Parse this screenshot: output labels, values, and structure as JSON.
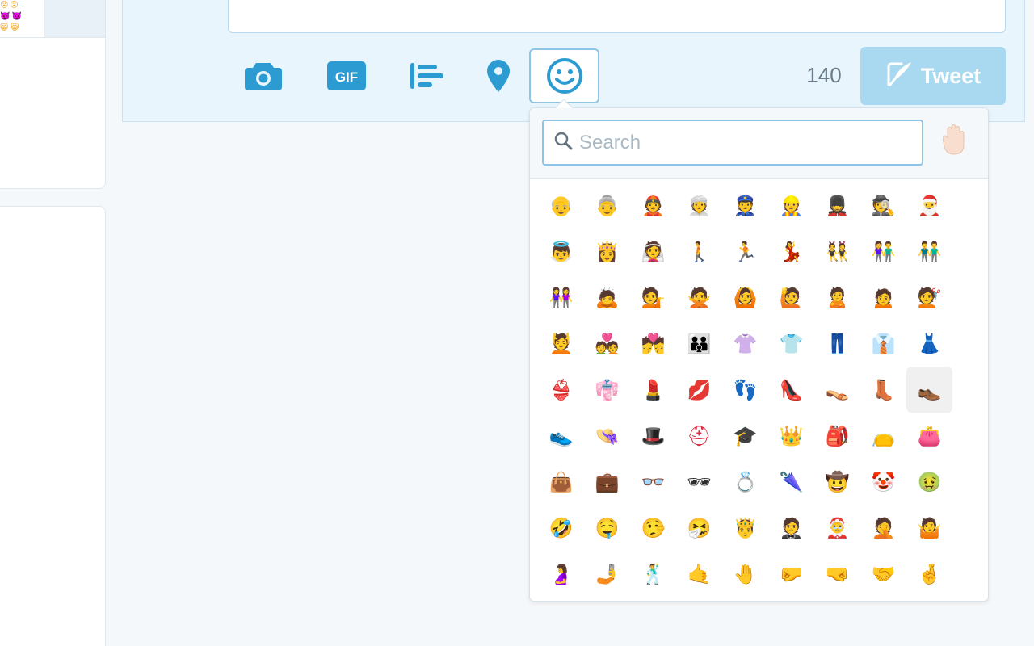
{
  "toolbar": {
    "counter": "140",
    "tweet_label": "Tweet",
    "accent": "#1da1f2",
    "icon_color": "#2b9bd1"
  },
  "picker": {
    "search_placeholder": "Search",
    "skin_tone_icon": "raised-hand",
    "highlighted_index": 44,
    "emojis": [
      {
        "name": "older-man",
        "glyph": "👴",
        "color": "#f3d6c4"
      },
      {
        "name": "older-woman",
        "glyph": "👵",
        "color": "#f3d6c4"
      },
      {
        "name": "man-with-gua-pi-mao",
        "glyph": "👲",
        "color": "#f3d6c4"
      },
      {
        "name": "man-with-turban",
        "glyph": "👳",
        "color": "#5c9e52"
      },
      {
        "name": "police-officer",
        "glyph": "👮",
        "color": "#3c5a8a"
      },
      {
        "name": "construction-worker",
        "glyph": "👷",
        "color": "#f5c518"
      },
      {
        "name": "guardsman",
        "glyph": "💂",
        "color": "#c22f3a"
      },
      {
        "name": "detective",
        "glyph": "🕵",
        "color": "#66757f"
      },
      {
        "name": "santa-claus",
        "glyph": "🎅",
        "color": "#dd2e44"
      },
      {
        "name": "baby-angel",
        "glyph": "👼",
        "color": "#f3d6c4"
      },
      {
        "name": "princess",
        "glyph": "👸",
        "color": "#2e2e2e"
      },
      {
        "name": "bride-with-veil",
        "glyph": "👰",
        "color": "#e1e8ed"
      },
      {
        "name": "pedestrian",
        "glyph": "🚶",
        "color": "#5c9e52"
      },
      {
        "name": "runner",
        "glyph": "🏃",
        "color": "#3c8fd6"
      },
      {
        "name": "dancer",
        "glyph": "💃",
        "color": "#dd2e44"
      },
      {
        "name": "dancers",
        "glyph": "👯",
        "color": "#f5c518"
      },
      {
        "name": "couple",
        "glyph": "👫",
        "color": "#f5c518"
      },
      {
        "name": "two-men-holding-hands",
        "glyph": "👬",
        "color": "#f5c518"
      },
      {
        "name": "two-women-holding-hands",
        "glyph": "👭",
        "color": "#f5c518"
      },
      {
        "name": "person-bowing",
        "glyph": "🙇",
        "color": "#3c8fd6"
      },
      {
        "name": "information-desk-person",
        "glyph": "💁",
        "color": "#9266cc"
      },
      {
        "name": "no-good-gesture",
        "glyph": "🙅",
        "color": "#9266cc"
      },
      {
        "name": "ok-gesture",
        "glyph": "🙆",
        "color": "#9266cc"
      },
      {
        "name": "raising-hand",
        "glyph": "🙋",
        "color": "#9266cc"
      },
      {
        "name": "person-pouting",
        "glyph": "🙎",
        "color": "#9266cc"
      },
      {
        "name": "person-frowning",
        "glyph": "🙍",
        "color": "#9266cc"
      },
      {
        "name": "haircut",
        "glyph": "💇",
        "color": "#2e2e2e"
      },
      {
        "name": "face-massage",
        "glyph": "💆",
        "color": "#2e2e2e"
      },
      {
        "name": "couple-with-heart",
        "glyph": "💑",
        "color": "#f5c518"
      },
      {
        "name": "kiss",
        "glyph": "💏",
        "color": "#f5c518"
      },
      {
        "name": "family",
        "glyph": "👪",
        "color": "#f5c518"
      },
      {
        "name": "womans-clothes",
        "glyph": "👚",
        "color": "#9266cc"
      },
      {
        "name": "t-shirt",
        "glyph": "👕",
        "color": "#3c8fd6"
      },
      {
        "name": "jeans",
        "glyph": "👖",
        "color": "#3c8fd6"
      },
      {
        "name": "necktie",
        "glyph": "👔",
        "color": "#3c8fd6"
      },
      {
        "name": "dress",
        "glyph": "👗",
        "color": "#3c8fd6"
      },
      {
        "name": "bikini",
        "glyph": "👙",
        "color": "#9266cc"
      },
      {
        "name": "kimono",
        "glyph": "👘",
        "color": "#3c8fd6"
      },
      {
        "name": "lipstick",
        "glyph": "💄",
        "color": "#dd2e44"
      },
      {
        "name": "kiss-mark",
        "glyph": "💋",
        "color": "#dd2e44"
      },
      {
        "name": "footprints",
        "glyph": "👣",
        "color": "#662113"
      },
      {
        "name": "high-heeled-shoe",
        "glyph": "👠",
        "color": "#dd2e44"
      },
      {
        "name": "womans-sandal",
        "glyph": "👡",
        "color": "#c1694f"
      },
      {
        "name": "womans-boots",
        "glyph": "👢",
        "color": "#a0522d"
      },
      {
        "name": "mans-shoe",
        "glyph": "👞",
        "color": "#8b4513"
      },
      {
        "name": "athletic-shoe",
        "glyph": "👟",
        "color": "#3c8fd6"
      },
      {
        "name": "womans-hat",
        "glyph": "👒",
        "color": "#f5c518"
      },
      {
        "name": "top-hat",
        "glyph": "🎩",
        "color": "#2e2e2e"
      },
      {
        "name": "rescue-worker-helmet",
        "glyph": "⛑",
        "color": "#dd2e44"
      },
      {
        "name": "graduation-cap",
        "glyph": "🎓",
        "color": "#2e2e2e"
      },
      {
        "name": "crown",
        "glyph": "👑",
        "color": "#f5c518"
      },
      {
        "name": "school-backpack",
        "glyph": "🎒",
        "color": "#a0041e"
      },
      {
        "name": "pouch",
        "glyph": "👝",
        "color": "#a6d388"
      },
      {
        "name": "purse",
        "glyph": "👛",
        "color": "#dd2e44"
      },
      {
        "name": "handbag",
        "glyph": "👜",
        "color": "#9266cc"
      },
      {
        "name": "briefcase",
        "glyph": "💼",
        "color": "#8b4513"
      },
      {
        "name": "eyeglasses",
        "glyph": "👓",
        "color": "#2e2e2e"
      },
      {
        "name": "dark-sunglasses",
        "glyph": "🕶",
        "color": "#2e2e2e"
      },
      {
        "name": "ring",
        "glyph": "💍",
        "color": "#99aab5"
      },
      {
        "name": "closed-umbrella",
        "glyph": "🌂",
        "color": "#9266cc"
      },
      {
        "name": "cowboy-hat-face",
        "glyph": "🤠",
        "color": "#f5c518"
      },
      {
        "name": "clown-face",
        "glyph": "🤡",
        "color": "#dd2e44"
      },
      {
        "name": "nauseated-face",
        "glyph": "🤢",
        "color": "#5c9e52"
      },
      {
        "name": "rolling-on-the-floor-laughing",
        "glyph": "🤣",
        "color": "#f5c518"
      },
      {
        "name": "drooling-face",
        "glyph": "🤤",
        "color": "#f5c518"
      },
      {
        "name": "lying-face",
        "glyph": "🤥",
        "color": "#f5c518"
      },
      {
        "name": "sneezing-face",
        "glyph": "🤧",
        "color": "#f5c518"
      },
      {
        "name": "prince",
        "glyph": "🤴",
        "color": "#f3d6c4"
      },
      {
        "name": "man-in-tuxedo",
        "glyph": "🤵",
        "color": "#2e2e2e"
      },
      {
        "name": "mother-christmas",
        "glyph": "🤶",
        "color": "#dd2e44"
      },
      {
        "name": "face-palm",
        "glyph": "🤦",
        "color": "#9266cc"
      },
      {
        "name": "shrug",
        "glyph": "🤷",
        "color": "#9266cc"
      },
      {
        "name": "pregnant-woman",
        "glyph": "🤰",
        "color": "#9266cc"
      },
      {
        "name": "selfie",
        "glyph": "🤳",
        "color": "#5c9e52"
      },
      {
        "name": "man-dancing",
        "glyph": "🕺",
        "color": "#2e2e2e"
      },
      {
        "name": "call-me-hand",
        "glyph": "🤙",
        "color": "#f3d6c4"
      },
      {
        "name": "raised-back-of-hand",
        "glyph": "🤚",
        "color": "#f3d6c4"
      },
      {
        "name": "left-facing-fist",
        "glyph": "🤛",
        "color": "#f3d6c4"
      },
      {
        "name": "right-facing-fist",
        "glyph": "🤜",
        "color": "#f3d6c4"
      },
      {
        "name": "handshake",
        "glyph": "🤝",
        "color": "#f3d6c4"
      },
      {
        "name": "crossed-fingers",
        "glyph": "🤞",
        "color": "#f3d6c4"
      }
    ]
  }
}
